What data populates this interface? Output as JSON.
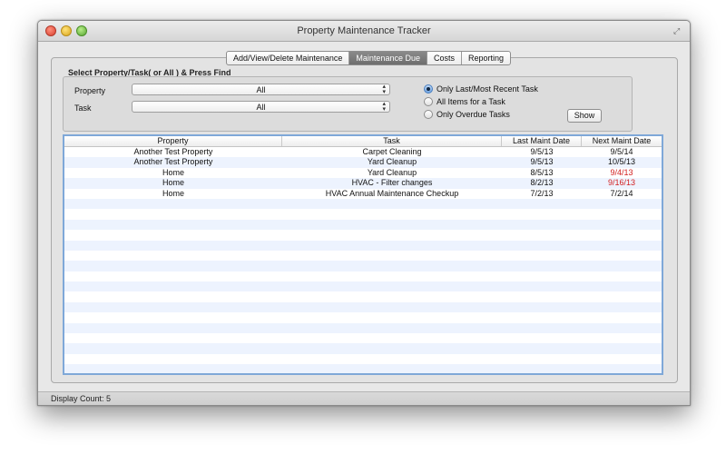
{
  "window": {
    "title": "Property Maintenance Tracker"
  },
  "tabs": [
    {
      "label": "Add/View/Delete Maintenance",
      "active": false
    },
    {
      "label": "Maintenance Due",
      "active": true
    },
    {
      "label": "Costs",
      "active": false
    },
    {
      "label": "Reporting",
      "active": false
    }
  ],
  "filter": {
    "group_label": "Select Property/Task( or All ) & Press Find",
    "property_label": "Property",
    "property_value": "All",
    "task_label": "Task",
    "task_value": "All",
    "options": [
      {
        "label": "Only Last/Most Recent Task",
        "selected": true
      },
      {
        "label": "All Items for a Task",
        "selected": false
      },
      {
        "label": "Only Overdue Tasks",
        "selected": false
      }
    ],
    "show_label": "Show"
  },
  "table": {
    "columns": [
      "Property",
      "Task",
      "Last Maint Date",
      "Next Maint Date"
    ],
    "rows": [
      {
        "property": "Another Test Property",
        "task": "Carpet Cleaning",
        "last": "9/5/13",
        "next": "9/5/14",
        "overdue": false
      },
      {
        "property": "Another Test Property",
        "task": "Yard Cleanup",
        "last": "9/5/13",
        "next": "10/5/13",
        "overdue": false
      },
      {
        "property": "Home",
        "task": "Yard Cleanup",
        "last": "8/5/13",
        "next": "9/4/13",
        "overdue": true
      },
      {
        "property": "Home",
        "task": "HVAC - Filter changes",
        "last": "8/2/13",
        "next": "9/16/13",
        "overdue": true
      },
      {
        "property": "Home",
        "task": "HVAC Annual Maintenance Checkup",
        "last": "7/2/13",
        "next": "7/2/14",
        "overdue": false
      }
    ]
  },
  "status": {
    "display_count": "Display Count: 5"
  },
  "colors": {
    "overdue": "#d22020",
    "selection_border": "#7fa8d8",
    "stripe": "#edf3fe"
  }
}
